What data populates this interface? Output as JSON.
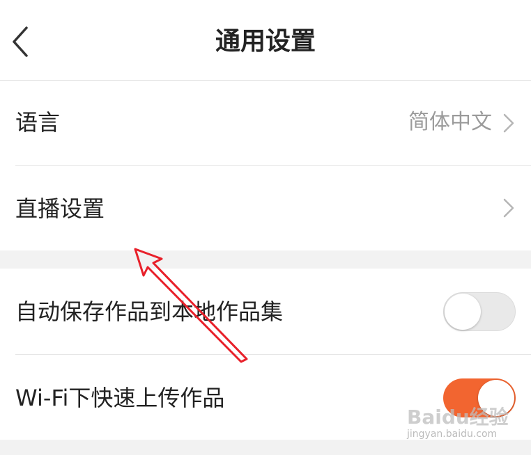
{
  "header": {
    "title": "通用设置",
    "back_icon": "chevron-left-icon"
  },
  "rows": {
    "language": {
      "label": "语言",
      "value": "简体中文",
      "icon": "chevron-right-icon"
    },
    "live": {
      "label": "直播设置",
      "icon": "chevron-right-icon"
    },
    "auto_save": {
      "label": "自动保存作品到本地作品集",
      "toggle_on": false
    },
    "wifi_upload": {
      "label": "Wi-Fi下快速上传作品",
      "toggle_on": true
    }
  },
  "colors": {
    "accent": "#f26530",
    "annotation_arrow": "#e8202a",
    "text_primary": "#222222",
    "text_secondary": "#9b9b9b",
    "divider": "#e6e6e6",
    "section_bg": "#f2f2f2"
  },
  "watermark": {
    "logo": "Baidu经验",
    "url": "jingyan.baidu.com"
  }
}
